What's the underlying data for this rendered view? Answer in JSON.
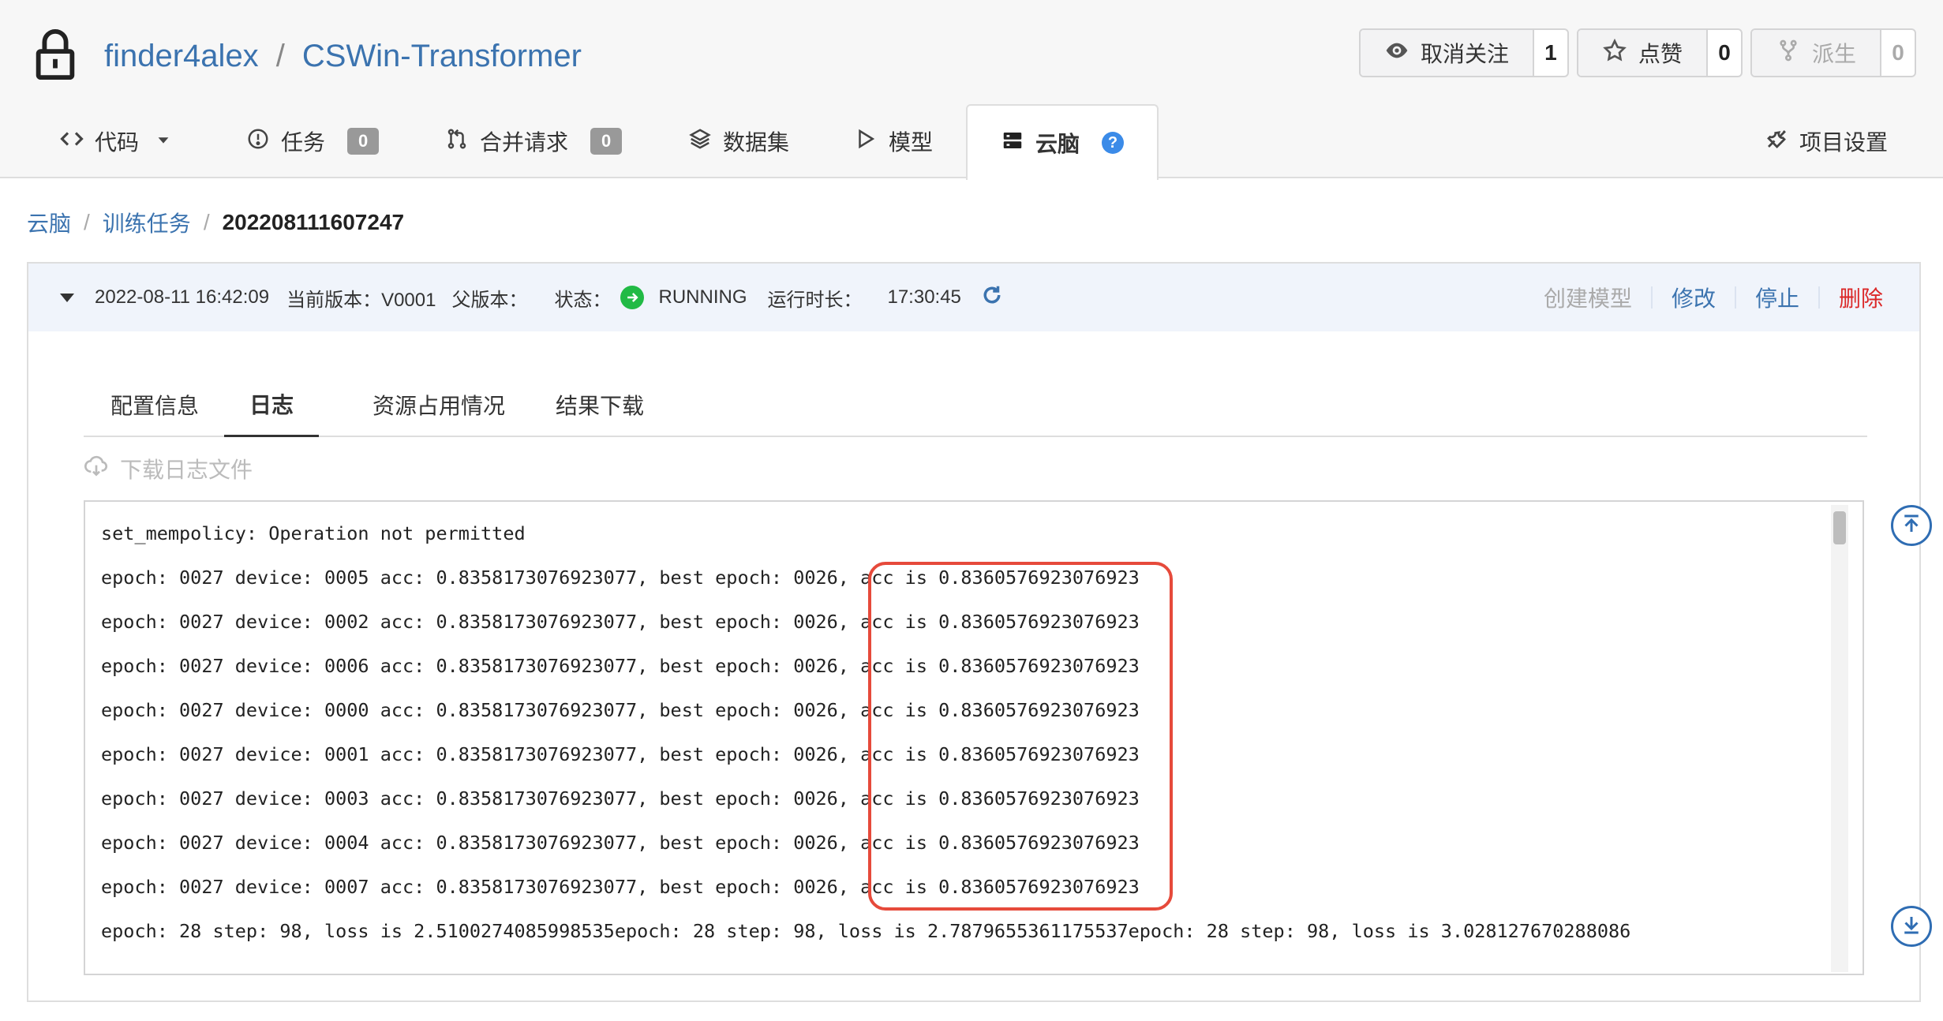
{
  "repo": {
    "owner": "finder4alex",
    "separator": "/",
    "name": "CSWin-Transformer",
    "lock_icon": "lock-icon"
  },
  "repo_buttons": {
    "watch": {
      "label": "取消关注",
      "count": "1",
      "icon": "eye-icon"
    },
    "star": {
      "label": "点赞",
      "count": "0",
      "icon": "star-icon"
    },
    "fork": {
      "label": "派生",
      "count": "0",
      "icon": "fork-icon"
    }
  },
  "tabs": {
    "code": {
      "label": "代码",
      "icon": "code-icon"
    },
    "issues": {
      "label": "任务",
      "badge": "0",
      "icon": "issue-icon"
    },
    "pulls": {
      "label": "合并请求",
      "badge": "0",
      "icon": "pull-request-icon"
    },
    "datasets": {
      "label": "数据集",
      "icon": "layers-icon"
    },
    "models": {
      "label": "模型",
      "icon": "play-icon"
    },
    "cloudbrain": {
      "label": "云脑",
      "icon": "server-icon",
      "help": "?"
    },
    "settings": {
      "label": "项目设置",
      "icon": "tools-icon"
    }
  },
  "breadcrumb": {
    "root": "云脑",
    "sep": "/",
    "section": "训练任务",
    "current": "202208111607247"
  },
  "job": {
    "created": "2022-08-11 16:42:09",
    "version_label": "当前版本：V0001",
    "parent_label": "父版本：",
    "status_label": "状态：",
    "status": "RUNNING",
    "status_color": "#21ba45",
    "duration_label": "运行时长：",
    "duration": "17:30:45"
  },
  "actions": {
    "create_model": "创建模型",
    "modify": "修改",
    "stop": "停止",
    "delete": "删除"
  },
  "subtabs": {
    "config": "配置信息",
    "log": "日志",
    "resources": "资源占用情况",
    "results": "结果下载"
  },
  "download_log": "下载日志文件",
  "log": {
    "partial_top": "                                                                                ",
    "lines": [
      "set_mempolicy: Operation not permitted",
      "epoch: 0027 device: 0005 acc: 0.8358173076923077, best epoch: 0026, acc is 0.8360576923076923",
      "epoch: 0027 device: 0002 acc: 0.8358173076923077, best epoch: 0026, acc is 0.8360576923076923",
      "epoch: 0027 device: 0006 acc: 0.8358173076923077, best epoch: 0026, acc is 0.8360576923076923",
      "epoch: 0027 device: 0000 acc: 0.8358173076923077, best epoch: 0026, acc is 0.8360576923076923",
      "epoch: 0027 device: 0001 acc: 0.8358173076923077, best epoch: 0026, acc is 0.8360576923076923",
      "epoch: 0027 device: 0003 acc: 0.8358173076923077, best epoch: 0026, acc is 0.8360576923076923",
      "epoch: 0027 device: 0004 acc: 0.8358173076923077, best epoch: 0026, acc is 0.8360576923076923",
      "epoch: 0027 device: 0007 acc: 0.8358173076923077, best epoch: 0026, acc is 0.8360576923076923",
      "epoch: 28 step: 98, loss is 2.5100274085998535epoch: 28 step: 98, loss is 2.7879655361175537epoch: 28 step: 98, loss is 3.028127670288086"
    ]
  },
  "colors": {
    "link": "#3b73af",
    "danger": "#db2828",
    "highlight_border": "#e64a3b",
    "scroll_button": "#2f6db3"
  }
}
